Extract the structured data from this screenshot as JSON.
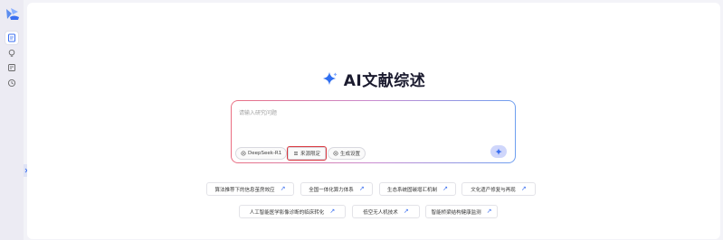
{
  "app": {
    "title": "AI文献综述",
    "brand_color": "#3b6ff0"
  },
  "sidebar": {
    "items": [
      {
        "icon": "document-icon",
        "active": true
      },
      {
        "icon": "lightbulb-icon",
        "active": false
      },
      {
        "icon": "notes-icon",
        "active": false
      },
      {
        "icon": "clock-icon",
        "active": false
      }
    ]
  },
  "composer": {
    "placeholder": "请输入研究问题",
    "model_label": "DeepSeek-R1",
    "source_label": "来源限定",
    "settings_label": "生成设置"
  },
  "suggestions": {
    "row1": [
      "算法推荐下的信息茧房效应",
      "全国一体化算力体系",
      "生态系统固碳增汇机制",
      "文化遗产修复与再现"
    ],
    "row2": [
      "人工智能医学影像诊断的临床转化",
      "低空无人机技术",
      "智能桥梁结构健康监测"
    ]
  }
}
